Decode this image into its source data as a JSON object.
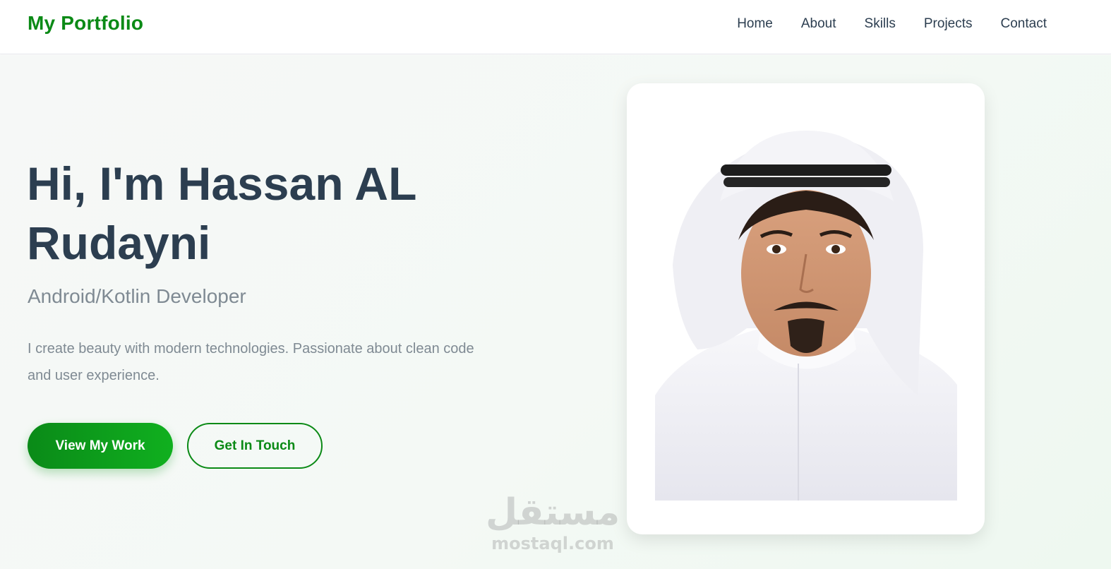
{
  "navbar": {
    "brand": "My Portfolio",
    "links": [
      "Home",
      "About",
      "Skills",
      "Projects",
      "Contact"
    ]
  },
  "hero": {
    "title": "Hi, I'm Hassan AL Rudayni",
    "subtitle": "Android/Kotlin Developer",
    "description": "I create beauty with modern technologies. Passionate about clean code and user experience.",
    "primary_button": "View My Work",
    "secondary_button": "Get In Touch"
  },
  "watermark": {
    "arabic": "مستقل",
    "latin": "mostaql.com"
  },
  "colors": {
    "accent": "#0b8a16",
    "heading": "#2c3e50",
    "muted": "#7f8a93"
  }
}
